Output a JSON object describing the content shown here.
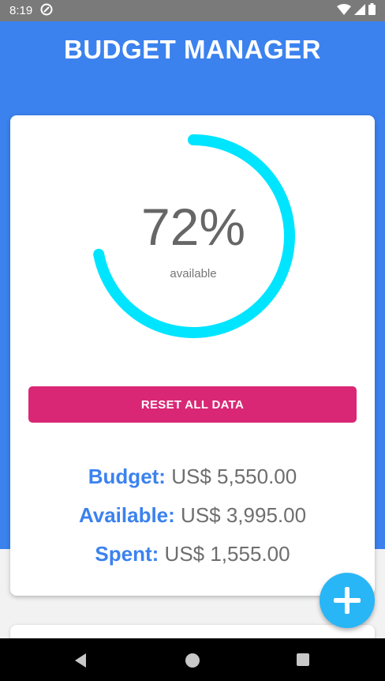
{
  "status_bar": {
    "time": "8:19"
  },
  "app": {
    "title": "BUDGET MANAGER"
  },
  "progress": {
    "percent_value": 72,
    "percent_text": "72%",
    "label": "available",
    "color": "#00e5ff"
  },
  "reset_button": {
    "label": "RESET ALL DATA",
    "color": "#d92775"
  },
  "summary": {
    "budget_label": "Budget:",
    "budget_value": "US$ 5,550.00",
    "available_label": "Available:",
    "available_value": "US$ 3,995.00",
    "spent_label": "Spent:",
    "spent_value": "US$ 1,555.00"
  },
  "fab": {
    "icon": "plus-icon",
    "color": "#29b6f6"
  },
  "colors": {
    "header": "#3b82ef",
    "accent": "#3b82ef"
  }
}
